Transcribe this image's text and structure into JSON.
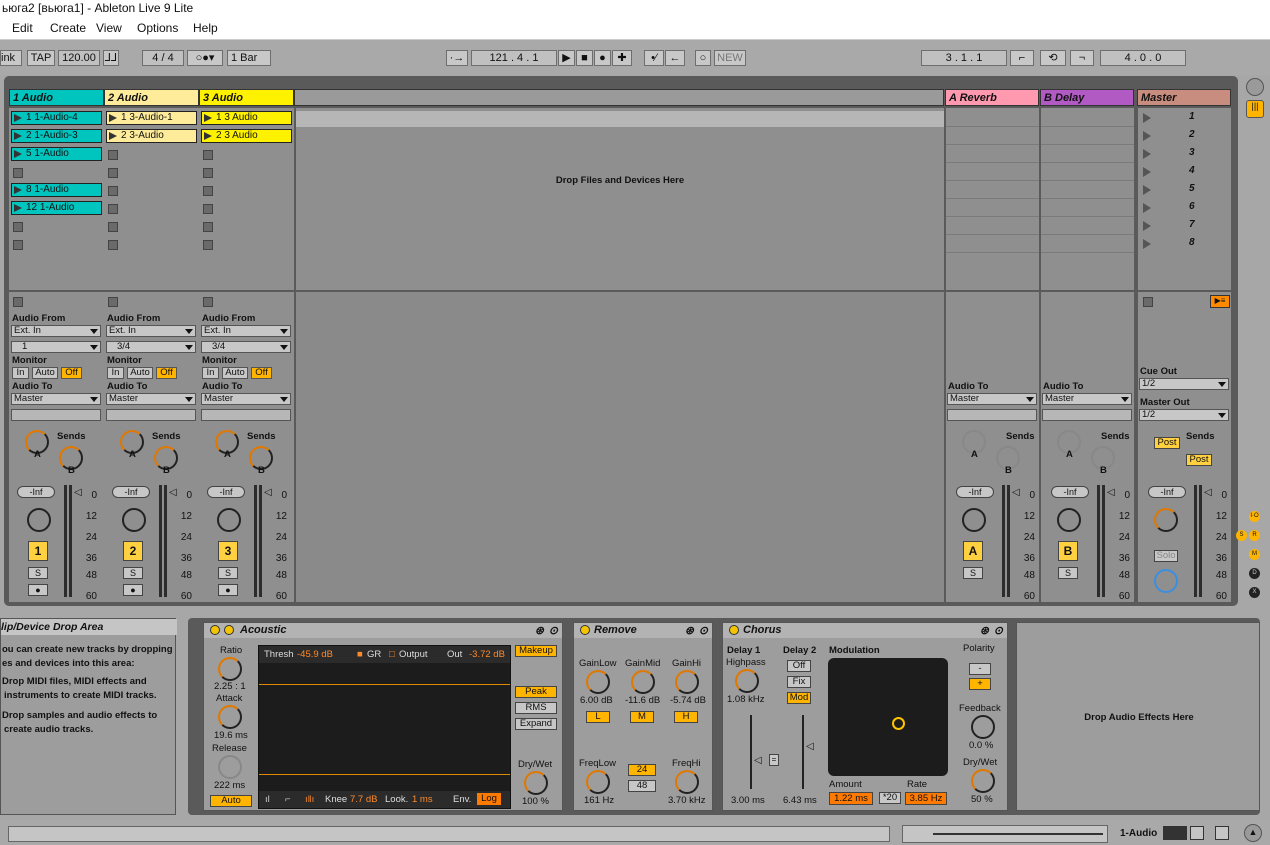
{
  "window": {
    "title": "ьюга2  [вьюга1] - Ableton Live 9 Lite"
  },
  "menu": [
    "Edit",
    "Create",
    "View",
    "Options",
    "Help"
  ],
  "control_bar": {
    "link": "ink",
    "tap": "TAP",
    "tempo": "120.00",
    "signature": "4  /  4",
    "quantize": "1 Bar",
    "position": "121 .   4 .   1",
    "new_label": "NEW",
    "loop_start": "3 .   1 .   1",
    "loop_length": "4 .   0 .   0"
  },
  "tracks": [
    {
      "name": "1 Audio",
      "color": "#00c4be",
      "number": "1",
      "clips": [
        "1 1-Audio-4",
        "2 1-Audio-3",
        "5 1-Audio",
        "",
        "8 1-Audio",
        "12 1-Audio",
        "",
        ""
      ],
      "audio_from": "Ext. In",
      "input": "1",
      "audio_to": "Master"
    },
    {
      "name": "2 Audio",
      "color": "#ffec9a",
      "number": "2",
      "clips": [
        "1 3-Audio-1",
        "2 3-Audio",
        "",
        "",
        "",
        "",
        "",
        ""
      ],
      "audio_from": "Ext. In",
      "input": "3/4",
      "audio_to": "Master"
    },
    {
      "name": "3 Audio",
      "color": "#fff200",
      "number": "3",
      "clips": [
        "1 3 Audio",
        "2 3 Audio",
        "",
        "",
        "",
        "",
        "",
        ""
      ],
      "audio_from": "Ext. In",
      "input": "3/4",
      "audio_to": "Master"
    }
  ],
  "returns": [
    {
      "name": "A Reverb",
      "color": "#ff99b0",
      "number": "A",
      "audio_to": "Master"
    },
    {
      "name": "B Delay",
      "color": "#b15ac4",
      "number": "B",
      "audio_to": "Master"
    }
  ],
  "master": {
    "name": "Master",
    "color": "#c88d7f",
    "scenes": [
      "1",
      "2",
      "3",
      "4",
      "5",
      "6",
      "7",
      "8"
    ],
    "cue_out_label": "Cue Out",
    "cue_out": "1/2",
    "master_out_label": "Master Out",
    "master_out": "1/2",
    "post": "Post",
    "solo": "Solo"
  },
  "labels": {
    "drop_files": "Drop Files and Devices Here",
    "audio_from": "Audio From",
    "monitor": "Monitor",
    "audio_to": "Audio To",
    "in": "In",
    "auto": "Auto",
    "off": "Off",
    "sends": "Sends",
    "send_a": "A",
    "send_b": "B",
    "inf": "-Inf",
    "s": "S"
  },
  "meter_scale": [
    "0",
    "12",
    "24",
    "36",
    "48",
    "60"
  ],
  "help_panel": {
    "title": "lip/Device Drop Area",
    "lines": [
      "ou can create new tracks by dropping",
      "es and devices into this area:",
      "Drop MIDI files, MIDI effects and",
      "instruments to create MIDI tracks.",
      "Drop samples and audio effects to",
      "create audio tracks."
    ]
  },
  "devices": {
    "compressor": {
      "name": "Acoustic",
      "ratio_label": "Ratio",
      "ratio": "2.25 : 1",
      "attack_label": "Attack",
      "attack": "19.6 ms",
      "release_label": "Release",
      "release": "222 ms",
      "auto": "Auto",
      "thresh_label": "Thresh",
      "thresh": "-45.9 dB",
      "gr": "GR",
      "output": "Output",
      "out_label": "Out",
      "out": "-3.72 dB",
      "makeup": "Makeup",
      "peak": "Peak",
      "rms": "RMS",
      "expand": "Expand",
      "knee_label": "Knee",
      "knee": "7.7 dB",
      "look_label": "Look.",
      "look": "1 ms",
      "env_label": "Env.",
      "log": "Log",
      "drywet_label": "Dry/Wet",
      "drywet": "100 %"
    },
    "eq": {
      "name": "Remove",
      "gainlow_label": "GainLow",
      "gainlow": "6.00 dB",
      "gainmid_label": "GainMid",
      "gainmid": "-11.6 dB",
      "gainhi_label": "GainHi",
      "gainhi": "-5.74 dB",
      "l": "L",
      "m": "M",
      "h": "H",
      "freqlow_label": "FreqLow",
      "freqlow": "161 Hz",
      "slope24": "24",
      "slope48": "48",
      "freqhi_label": "FreqHi",
      "freqhi": "3.70 kHz"
    },
    "chorus": {
      "name": "Chorus",
      "delay1_label": "Delay 1",
      "highpass_label": "Highpass",
      "highpass": "1.08 kHz",
      "delay2_label": "Delay 2",
      "off": "Off",
      "fix": "Fix",
      "mod": "Mod",
      "delay1": "3.00 ms",
      "delay2": "6.43 ms",
      "modulation_label": "Modulation",
      "amount_label": "Amount",
      "amount": "1.22 ms",
      "rate_label": "Rate",
      "rate_mult": "*20",
      "rate": "3.85 Hz",
      "polarity_label": "Polarity",
      "minus": "-",
      "plus": "+",
      "feedback_label": "Feedback",
      "feedback": "0.0 %",
      "drywet_label": "Dry/Wet",
      "drywet": "50 %"
    },
    "drop_effects": "Drop Audio Effects Here"
  },
  "status": {
    "track": "1-Audio"
  }
}
